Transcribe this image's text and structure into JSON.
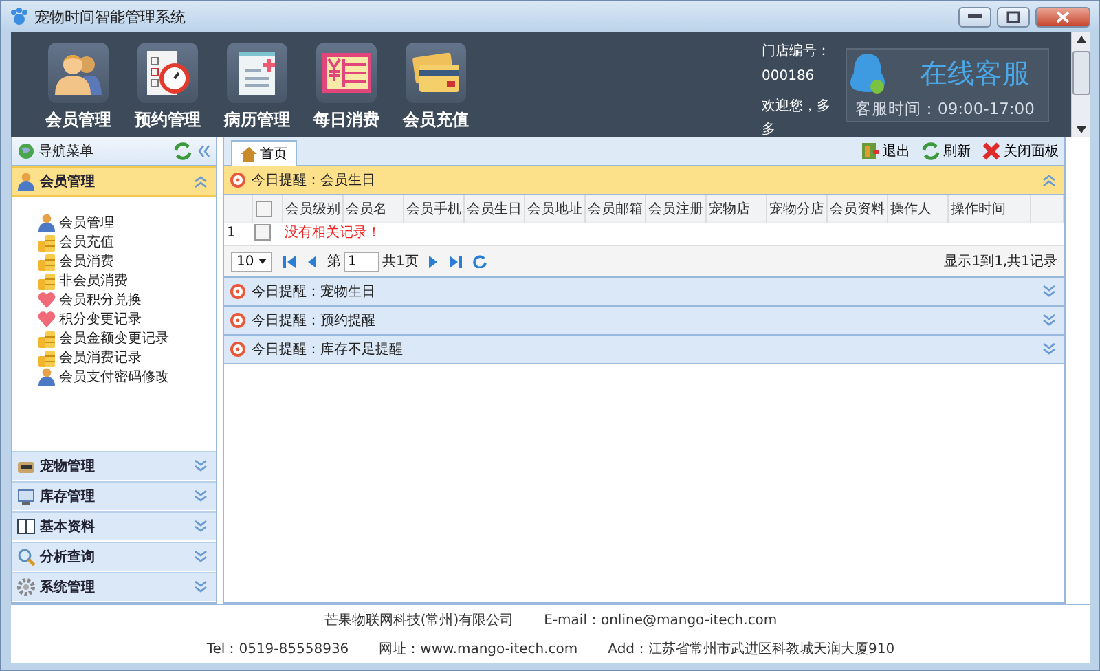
{
  "window": {
    "title": "宠物时间智能管理系统"
  },
  "toolbar": [
    {
      "label": "会员管理",
      "kind": "members"
    },
    {
      "label": "预约管理",
      "kind": "appointment"
    },
    {
      "label": "病历管理",
      "kind": "records"
    },
    {
      "label": "每日消费",
      "kind": "daily"
    },
    {
      "label": "会员充值",
      "kind": "recharge"
    }
  ],
  "store_info": {
    "store": "门店编号：000186",
    "welcome": "欢迎您，多多"
  },
  "service": {
    "title": "在线客服",
    "hours": "客服时间：09:00-17:00"
  },
  "sidebar": {
    "title": "导航菜单",
    "groups": [
      {
        "label": "会员管理",
        "kind": "members",
        "expanded": true,
        "items": [
          {
            "label": "会员管理",
            "kind": "person"
          },
          {
            "label": "会员充值",
            "kind": "coins"
          },
          {
            "label": "会员消费",
            "kind": "coins"
          },
          {
            "label": "非会员消费",
            "kind": "coins"
          },
          {
            "label": "会员积分兑换",
            "kind": "heart"
          },
          {
            "label": "积分变更记录",
            "kind": "heart"
          },
          {
            "label": "会员金额变更记录",
            "kind": "coins"
          },
          {
            "label": "会员消费记录",
            "kind": "coins"
          },
          {
            "label": "会员支付密码修改",
            "kind": "person"
          }
        ]
      },
      {
        "label": "宠物管理",
        "kind": "pet",
        "expanded": false
      },
      {
        "label": "库存管理",
        "kind": "stock",
        "expanded": false
      },
      {
        "label": "基本资料",
        "kind": "book",
        "expanded": false
      },
      {
        "label": "分析查询",
        "kind": "search",
        "expanded": false
      },
      {
        "label": "系统管理",
        "kind": "gear",
        "expanded": false
      }
    ]
  },
  "tabs": [
    {
      "label": "首页",
      "selected": true
    }
  ],
  "tab_actions": [
    {
      "label": "退出",
      "kind": "exit"
    },
    {
      "label": "刷新",
      "kind": "refresh"
    },
    {
      "label": "关闭面板",
      "kind": "close"
    }
  ],
  "panels": [
    {
      "title": "今日提醒：会员生日",
      "expanded": true,
      "table": {
        "select_all": false,
        "columns": [
          "会员级别",
          "会员名",
          "会员手机",
          "会员生日",
          "会员地址",
          "会员邮箱",
          "会员注册",
          "宠物店",
          "宠物分店",
          "会员资料",
          "操作人",
          "操作时间"
        ],
        "rows": [
          {
            "index": "1",
            "checked": false,
            "message": "没有相关记录！"
          }
        ]
      },
      "pager": {
        "page_size": "10",
        "page_label": "第",
        "page": "1",
        "total_pages": "共1页",
        "summary": "显示1到1,共1记录"
      }
    },
    {
      "title": "今日提醒：宠物生日",
      "expanded": false
    },
    {
      "title": "今日提醒：预约提醒",
      "expanded": false
    },
    {
      "title": "今日提醒：库存不足提醒",
      "expanded": false
    }
  ],
  "footer": {
    "company": "芒果物联网科技(常州)有限公司",
    "email": "E-mail：online@mango-itech.com",
    "tel": "Tel：0519-85558936",
    "website": "网址：www.mango-itech.com",
    "address": "Add：江苏省常州市武进区科教城天润大厦910"
  }
}
